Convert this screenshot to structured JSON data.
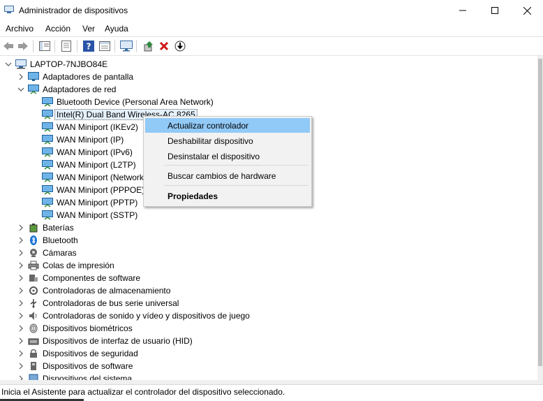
{
  "window": {
    "title": "Administrador de dispositivos"
  },
  "menubar": {
    "items": [
      "Archivo",
      "Acción",
      "Ver",
      "Ayuda"
    ]
  },
  "toolbar": {
    "buttons": [
      "back-icon",
      "forward-icon",
      "show-hide-tree-icon",
      "properties-icon",
      "help-icon",
      "view-icon",
      "monitor-icon",
      "update-driver-icon",
      "uninstall-icon",
      "enable-device-icon"
    ],
    "colors": {
      "update": "#2a8a3a",
      "uninstall": "#d01818"
    }
  },
  "tree": {
    "root": "LAPTOP-7NJBO84E",
    "display_adapters": "Adaptadores de pantalla",
    "network_adapters": "Adaptadores de red",
    "network_children": [
      "Bluetooth Device (Personal Area Network)",
      "Intel(R) Dual Band Wireless-AC 8265",
      "WAN Miniport (IKEv2)",
      "WAN Miniport (IP)",
      "WAN Miniport (IPv6)",
      "WAN Miniport (L2TP)",
      "WAN Miniport (Network Monitor)",
      "WAN Miniport (PPPOE)",
      "WAN Miniport (PPTP)",
      "WAN Miniport (SSTP)"
    ],
    "categories": [
      "Baterías",
      "Bluetooth",
      "Cámaras",
      "Colas de impresión",
      "Componentes de software",
      "Controladoras de almacenamiento",
      "Controladoras de bus serie universal",
      "Controladoras de sonido y vídeo y dispositivos de juego",
      "Dispositivos biométricos",
      "Dispositivos de interfaz de usuario (HID)",
      "Dispositivos de seguridad",
      "Dispositivos de software",
      "Dispositivos del sistema"
    ]
  },
  "context_menu": {
    "items": [
      "Actualizar controlador",
      "Deshabilitar dispositivo",
      "Desinstalar el dispositivo",
      "Buscar cambios de hardware",
      "Propiedades"
    ],
    "highlighted": "Actualizar controlador",
    "highlight_color": "#91c9f7"
  },
  "status": {
    "text": "Inicia el Asistente para actualizar el controlador del dispositivo seleccionado."
  }
}
